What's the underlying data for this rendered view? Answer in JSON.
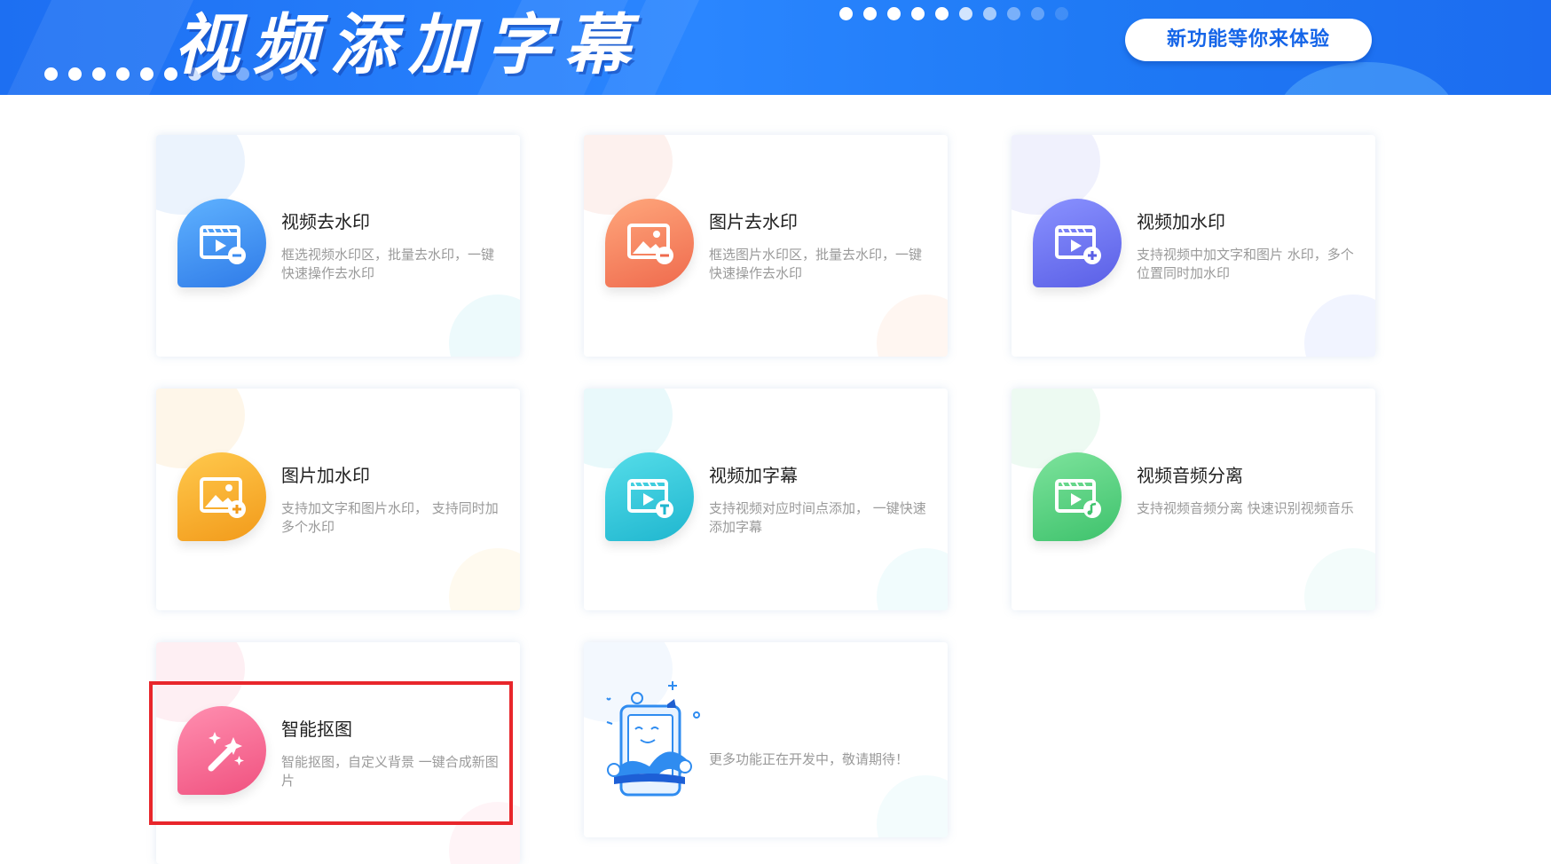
{
  "banner": {
    "title": "视频添加字幕",
    "new_feature_button": "新功能等你来体验"
  },
  "cards": [
    {
      "title": "视频去水印",
      "desc": "框选视频水印区，批量去水印，一键快速操作去水印",
      "icon": "video-remove-watermark-icon",
      "color": "#3b8cf0"
    },
    {
      "title": "图片去水印",
      "desc": "框选图片水印区，批量去水印，一键快速操作去水印",
      "icon": "image-remove-watermark-icon",
      "color": "#f07a58"
    },
    {
      "title": "视频加水印",
      "desc": "支持视频中加文字和图片 水印，多个位置同时加水印",
      "icon": "video-add-watermark-icon",
      "color": "#6a74f0"
    },
    {
      "title": "图片加水印",
      "desc": "支持加文字和图片水印， 支持同时加多个水印",
      "icon": "image-add-watermark-icon",
      "color": "#f5a623"
    },
    {
      "title": "视频加字幕",
      "desc": "支持视频对应时间点添加， 一键快速添加字幕",
      "icon": "video-add-subtitle-icon",
      "color": "#27c7d8"
    },
    {
      "title": "视频音频分离",
      "desc": "支持视频音频分离 快速识别视频音乐",
      "icon": "video-audio-separate-icon",
      "color": "#52cf7e"
    },
    {
      "title": "智能抠图",
      "desc": "智能抠图，自定义背景 一键合成新图片",
      "icon": "magic-wand-icon",
      "color": "#f5628e"
    }
  ],
  "coming_soon": {
    "text": "更多功能正在开发中，敬请期待！",
    "icon": "developer-illustration-icon"
  }
}
